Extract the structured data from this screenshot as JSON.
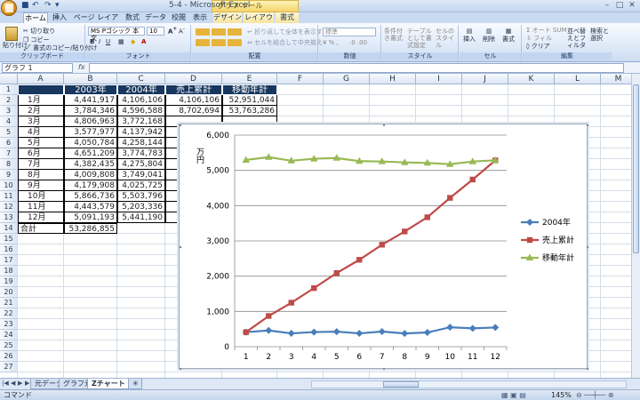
{
  "window": {
    "title": "5-4 - Microsoft Excel",
    "context_tab": "グラフ ツール"
  },
  "tabs": [
    {
      "label": "ホーム"
    },
    {
      "label": "挿入"
    },
    {
      "label": "ページ レイアウト"
    },
    {
      "label": "数式"
    },
    {
      "label": "データ"
    },
    {
      "label": "校閲"
    },
    {
      "label": "表示"
    },
    {
      "label": "デザイン"
    },
    {
      "label": "レイアウト"
    },
    {
      "label": "書式"
    }
  ],
  "ribbon": {
    "paste": "貼り付け",
    "cut": "切り取り",
    "copy": "コピー",
    "format_painter": "書式のコピー/貼り付け",
    "clipboard": "クリップボード",
    "font_name": "MS Pゴシック 本文",
    "font_size": "10",
    "font": "フォント",
    "wrap": "折り返して全体を表示する",
    "merge": "セルを結合して中央揃え",
    "alignment": "配置",
    "number_format": "標準",
    "number": "数値",
    "cond_format": "条件付き書式",
    "table_format": "テーブルとして書式設定",
    "cell_style": "セルのスタイル",
    "style": "スタイル",
    "insert": "挿入",
    "delete": "削除",
    "format": "書式",
    "cells": "セル",
    "autosum": "オート SUM",
    "fill": "フィル",
    "clear": "クリア",
    "sort": "並べ替えとフィルタ",
    "find": "検索と選択",
    "editing": "編集"
  },
  "formula_bar": {
    "name_box": "グラフ 1",
    "fx": "fx"
  },
  "columns": [
    "A",
    "B",
    "C",
    "D",
    "E",
    "F",
    "G",
    "H",
    "I",
    "J",
    "K",
    "L",
    "M"
  ],
  "rows": [
    "1",
    "2",
    "3",
    "4",
    "5",
    "6",
    "7",
    "8",
    "9",
    "10",
    "11",
    "12",
    "13",
    "14",
    "15",
    "16",
    "17",
    "18",
    "19",
    "20",
    "21",
    "22",
    "23",
    "24",
    "25",
    "26",
    "27"
  ],
  "table": {
    "headers": [
      "2003年",
      "2004年",
      "売上累計",
      "移動年計"
    ],
    "data": [
      {
        "month": "1月",
        "y2003": "4,441,917",
        "y2004": "4,106,106",
        "cum": "4,106,106",
        "moving": "52,951,044"
      },
      {
        "month": "2月",
        "y2003": "3,784,346",
        "y2004": "4,596,588",
        "cum": "8,702,694",
        "moving": "53,763,286"
      },
      {
        "month": "3月",
        "y2003": "4,806,963",
        "y2004": "3,772,168",
        "cum": "",
        "moving": ""
      },
      {
        "month": "4月",
        "y2003": "3,577,977",
        "y2004": "4,137,942",
        "cum": "",
        "moving": ""
      },
      {
        "month": "5月",
        "y2003": "4,050,784",
        "y2004": "4,258,144",
        "cum": "",
        "moving": ""
      },
      {
        "month": "6月",
        "y2003": "4,651,209",
        "y2004": "3,774,783",
        "cum": "",
        "moving": ""
      },
      {
        "month": "7月",
        "y2003": "4,382,435",
        "y2004": "4,275,804",
        "cum": "",
        "moving": ""
      },
      {
        "month": "8月",
        "y2003": "4,009,808",
        "y2004": "3,749,041",
        "cum": "",
        "moving": ""
      },
      {
        "month": "9月",
        "y2003": "4,179,908",
        "y2004": "4,025,725",
        "cum": "",
        "moving": ""
      },
      {
        "month": "10月",
        "y2003": "5,866,736",
        "y2004": "5,503,796",
        "cum": "",
        "moving": ""
      },
      {
        "month": "11月",
        "y2003": "4,443,579",
        "y2004": "5,203,336",
        "cum": "",
        "moving": ""
      },
      {
        "month": "12月",
        "y2003": "5,091,193",
        "y2004": "5,441,190",
        "cum": "",
        "moving": ""
      }
    ],
    "total_label": "合計",
    "total_2003": "53,286,855"
  },
  "chart_data": {
    "type": "line",
    "title": "",
    "xlabel": "",
    "ylabel": "万円",
    "x": [
      1,
      2,
      3,
      4,
      5,
      6,
      7,
      8,
      9,
      10,
      11,
      12
    ],
    "ylim": [
      0,
      6000
    ],
    "yticks": [
      "0",
      "1,000",
      "2,000",
      "3,000",
      "4,000",
      "5,000",
      "6,000"
    ],
    "grid": true,
    "legend_position": "right",
    "series": [
      {
        "name": "2004年",
        "color": "#4a7ebb",
        "marker": "diamond",
        "values": [
          411,
          460,
          377,
          414,
          426,
          377,
          428,
          375,
          403,
          550,
          520,
          544
        ]
      },
      {
        "name": "売上累計",
        "color": "#be4b48",
        "marker": "square",
        "values": [
          411,
          870,
          1247,
          1661,
          2087,
          2464,
          2892,
          3267,
          3670,
          4220,
          4740,
          5284
        ]
      },
      {
        "name": "移動年計",
        "color": "#98b954",
        "marker": "triangle",
        "values": [
          5295,
          5376,
          5274,
          5330,
          5350,
          5262,
          5252,
          5226,
          5211,
          5175,
          5251,
          5286
        ]
      }
    ]
  },
  "sheets": [
    {
      "label": "元データ"
    },
    {
      "label": "グラフ元"
    },
    {
      "label": "Zチャート"
    }
  ],
  "status": {
    "mode": "コマンド",
    "zoom": "145%"
  }
}
